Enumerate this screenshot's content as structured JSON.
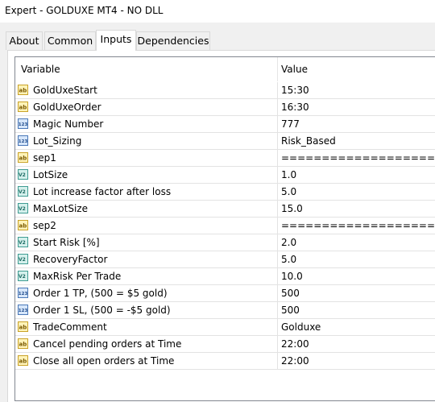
{
  "window": {
    "title": "Expert - GOLDUXE MT4 - NO DLL"
  },
  "tabs": [
    {
      "label": "About",
      "active": false
    },
    {
      "label": "Common",
      "active": false
    },
    {
      "label": "Inputs",
      "active": true
    },
    {
      "label": "Dependencies",
      "active": false
    }
  ],
  "grid": {
    "headers": {
      "variable": "Variable",
      "value": "Value"
    },
    "rows": [
      {
        "icon": "string-icon",
        "name": "GoldUxeStart",
        "value": "15:30"
      },
      {
        "icon": "string-icon",
        "name": "GoldUxeOrder",
        "value": "16:30"
      },
      {
        "icon": "integer-icon",
        "name": "Magic Number",
        "value": "777"
      },
      {
        "icon": "integer-icon",
        "name": "Lot_Sizing",
        "value": "Risk_Based"
      },
      {
        "icon": "string-icon",
        "name": "sep1",
        "value": "================================="
      },
      {
        "icon": "double-icon",
        "name": "LotSize",
        "value": "1.0"
      },
      {
        "icon": "double-icon",
        "name": "Lot increase factor after loss",
        "value": "5.0"
      },
      {
        "icon": "double-icon",
        "name": "MaxLotSize",
        "value": "15.0"
      },
      {
        "icon": "string-icon",
        "name": "sep2",
        "value": "================================="
      },
      {
        "icon": "double-icon",
        "name": "Start Risk [%]",
        "value": "2.0"
      },
      {
        "icon": "double-icon",
        "name": "RecoveryFactor",
        "value": "5.0"
      },
      {
        "icon": "double-icon",
        "name": "MaxRisk Per Trade",
        "value": "10.0"
      },
      {
        "icon": "integer-icon",
        "name": "Order 1 TP, (500 = $5 gold)",
        "value": "500"
      },
      {
        "icon": "integer-icon",
        "name": "Order 1 SL, (500 = -$5 gold)",
        "value": "500"
      },
      {
        "icon": "string-icon",
        "name": "TradeComment",
        "value": "Golduxe"
      },
      {
        "icon": "string-icon",
        "name": "Cancel pending orders at Time",
        "value": "22:00"
      },
      {
        "icon": "string-icon",
        "name": "Close all open orders at Time",
        "value": "22:00"
      }
    ]
  }
}
